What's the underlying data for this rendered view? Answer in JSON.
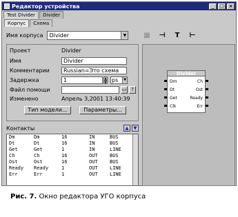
{
  "window": {
    "title": "Редактор устройства"
  },
  "doc_tabs": [
    "Test Divider",
    "Divider"
  ],
  "page_tabs": [
    "Корпус",
    "Схема"
  ],
  "korpus": {
    "label": "Имя корпуса",
    "value": "Divider"
  },
  "props": {
    "project_label": "Проект",
    "project_value": "Divider",
    "name_label": "Имя",
    "name_value": "Divider",
    "comment_label": "Комментарии",
    "comment_value": "Russian=Это схема",
    "delay_label": "Задержка",
    "delay_value": "1",
    "delay_unit": "ps",
    "help_label": "Файл помощи",
    "help_value": "",
    "changed_label": "Изменено",
    "changed_value": "Апрель 3,2001   13:40:39",
    "model_button": "Тип модели...",
    "params_button": "Параметры..."
  },
  "contacts": {
    "label": "Контакты",
    "rows": [
      [
        "Dm",
        "Dm",
        "16",
        "IN",
        "BUS"
      ],
      [
        "Dt",
        "Dt",
        "16",
        "IN",
        "BUS"
      ],
      [
        "Get",
        "Get",
        "1",
        "IN",
        "LINE"
      ],
      [
        "Ch",
        "Ch",
        "16",
        "OUT",
        "BUS"
      ],
      [
        "Ost",
        "Ost",
        "16",
        "OUT",
        "BUS"
      ],
      [
        "Ready",
        "Ready",
        "1",
        "OUT",
        "LINE"
      ],
      [
        "Err",
        "Err",
        "1",
        "OUT",
        "LINE"
      ]
    ]
  },
  "symbol": {
    "name": "Divider",
    "left_pins": [
      "Dm",
      "Dt",
      "Get",
      "Clk"
    ],
    "right_pins": [
      "Ch",
      "Ost",
      "Ready",
      "Err"
    ]
  },
  "caption": {
    "prefix": "Рис. 7.",
    "text": " Окно редактора УГО корпуса"
  }
}
